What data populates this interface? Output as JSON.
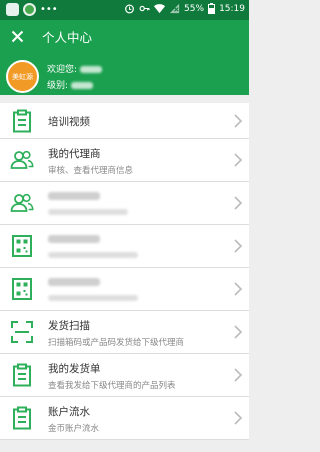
{
  "status_bar": {
    "battery": "55%",
    "time": "15:19",
    "icons": [
      "app-icon",
      "wechat-icon",
      "more-icon",
      "alarm-icon",
      "key-icon",
      "wifi-icon",
      "no-sim-icon",
      "battery-icon"
    ]
  },
  "app_bar": {
    "close_icon": "close-icon",
    "title": "个人中心"
  },
  "profile": {
    "avatar_text": "美虹源",
    "welcome_label": "欢迎您:",
    "level_label": "级别:"
  },
  "menu": {
    "items": [
      {
        "title": "培训视频",
        "subtitle": "",
        "icon": "clipboard-icon"
      },
      {
        "title": "我的代理商",
        "subtitle": "审核、查看代理商信息",
        "icon": "users-icon"
      },
      {
        "title": "",
        "subtitle": "",
        "icon": "users-icon"
      },
      {
        "title": "",
        "subtitle": "",
        "icon": "qrcode-icon"
      },
      {
        "title": "",
        "subtitle": "",
        "icon": "qrcode-icon"
      },
      {
        "title": "发货扫描",
        "subtitle": "扫描箱码或产品码发货给下级代理商",
        "icon": "scan-icon"
      },
      {
        "title": "我的发货单",
        "subtitle": "查看我发给下级代理商的产品列表",
        "icon": "clipboard-icon"
      },
      {
        "title": "账户流水",
        "subtitle": "金币账户流水",
        "icon": "clipboard-icon"
      }
    ]
  },
  "colors": {
    "brand_green": "#1aa04e",
    "status_green": "#0f7a3c",
    "icon_green": "#2eb05a",
    "avatar_orange": "#f29a26"
  }
}
